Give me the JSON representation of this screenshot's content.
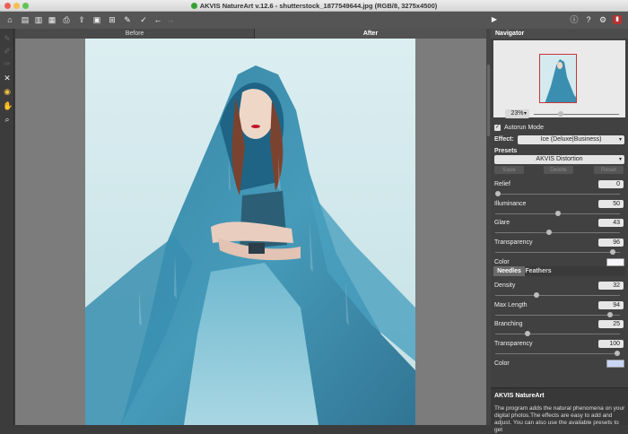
{
  "window": {
    "title": "AKVIS NatureArt v.12.6 - shutterstock_1877549644.jpg (RGB/8, 3275x4500)"
  },
  "canvas": {
    "tab_before": "Before",
    "tab_after": "After"
  },
  "navigator": {
    "header": "Navigator",
    "zoom": "23%",
    "zoom_level": 0.3
  },
  "settings": {
    "autorun_label": "Autorun Mode",
    "autorun_checked": true,
    "effect_label": "Effect:",
    "effect_value": "Ice (Deluxe|Business)",
    "presets_label": "Presets",
    "preset_value": "AKVIS Distortion",
    "save_label": "Save",
    "delete_label": "Delete",
    "reset_label": "Reset"
  },
  "params": [
    {
      "label": "Relief",
      "value": "0",
      "fraction": 0.0
    },
    {
      "label": "Illuminance",
      "value": "50",
      "fraction": 0.5
    },
    {
      "label": "Glare",
      "value": "43",
      "fraction": 0.43
    },
    {
      "label": "Transparency",
      "value": "96",
      "fraction": 0.96
    }
  ],
  "color1": {
    "label": "Color",
    "hex": "#f6f6fc"
  },
  "subtabs": {
    "needles": "Needles",
    "feathers": "Feathers",
    "active": "Needles"
  },
  "needles": [
    {
      "label": "Density",
      "value": "32",
      "fraction": 0.32
    },
    {
      "label": "Max Length",
      "value": "94",
      "fraction": 0.94
    },
    {
      "label": "Branching",
      "value": "25",
      "fraction": 0.25
    },
    {
      "label": "Transparency",
      "value": "100",
      "fraction": 1.0
    }
  ],
  "color2": {
    "label": "Color",
    "hex": "#c9d6f4"
  },
  "help": {
    "title": "AKVIS NatureArt",
    "text": "The program adds the natural phenomena on your digital photos.The effects are easy to add and adjust. You can also use the available presets to get"
  },
  "colors": {
    "accent": "#c03030",
    "panel": "#414141",
    "canvas_bg": "#7c7c7c"
  }
}
